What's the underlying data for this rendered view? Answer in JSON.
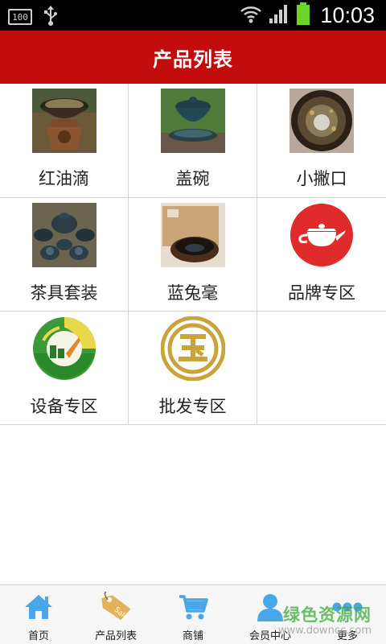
{
  "status_bar": {
    "battery_small_text": "100",
    "time": "10:03"
  },
  "header": {
    "title": "产品列表"
  },
  "products": [
    {
      "label": "红油滴",
      "icon": "teacup-on-stand-image"
    },
    {
      "label": "盖碗",
      "icon": "gaiwan-image"
    },
    {
      "label": "小撇口",
      "icon": "bowl-top-view-image"
    },
    {
      "label": "茶具套装",
      "icon": "tea-set-image"
    },
    {
      "label": "蓝兔毫",
      "icon": "blue-hare-bowl-image"
    },
    {
      "label": "品牌专区",
      "icon": "teapot-circle-icon"
    },
    {
      "label": "设备专区",
      "icon": "equipment-logo-icon"
    },
    {
      "label": "批发专区",
      "icon": "wholesale-logo-icon"
    }
  ],
  "bottom_nav": [
    {
      "label": "首页",
      "icon": "home-icon"
    },
    {
      "label": "产品列表",
      "icon": "price-tag-icon"
    },
    {
      "label": "商铺",
      "icon": "cart-icon"
    },
    {
      "label": "会员中心",
      "icon": "user-icon"
    },
    {
      "label": "更多",
      "icon": "more-dots-icon"
    }
  ],
  "watermark": {
    "main": "绿色资源网",
    "sub": "www.downcc.com"
  },
  "colors": {
    "header_bg": "#c30d0d",
    "nav_icon": "#47a7e8",
    "brand_red": "#e02b2b"
  }
}
